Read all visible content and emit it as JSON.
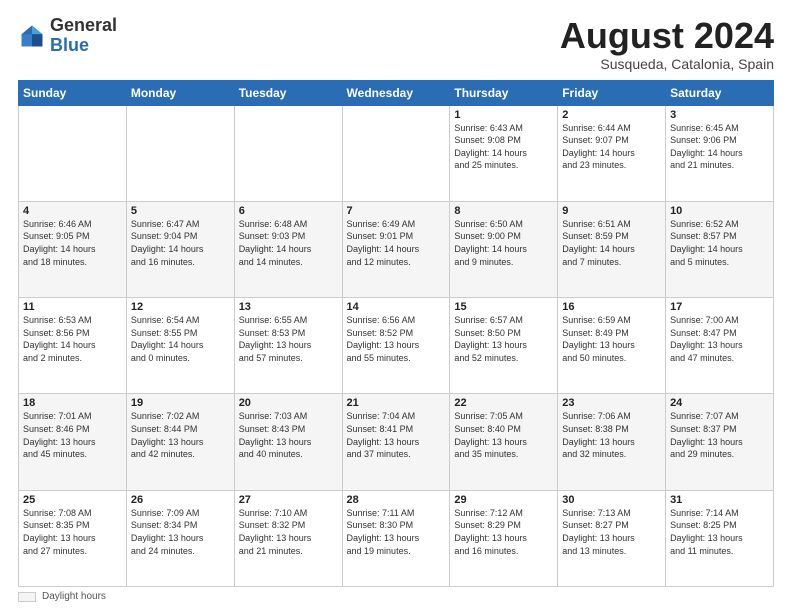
{
  "header": {
    "logo_general": "General",
    "logo_blue": "Blue",
    "month_year": "August 2024",
    "location": "Susqueda, Catalonia, Spain"
  },
  "weekdays": [
    "Sunday",
    "Monday",
    "Tuesday",
    "Wednesday",
    "Thursday",
    "Friday",
    "Saturday"
  ],
  "footer": {
    "label": "Daylight hours"
  },
  "weeks": [
    [
      {
        "day": "",
        "info": ""
      },
      {
        "day": "",
        "info": ""
      },
      {
        "day": "",
        "info": ""
      },
      {
        "day": "",
        "info": ""
      },
      {
        "day": "1",
        "info": "Sunrise: 6:43 AM\nSunset: 9:08 PM\nDaylight: 14 hours\nand 25 minutes."
      },
      {
        "day": "2",
        "info": "Sunrise: 6:44 AM\nSunset: 9:07 PM\nDaylight: 14 hours\nand 23 minutes."
      },
      {
        "day": "3",
        "info": "Sunrise: 6:45 AM\nSunset: 9:06 PM\nDaylight: 14 hours\nand 21 minutes."
      }
    ],
    [
      {
        "day": "4",
        "info": "Sunrise: 6:46 AM\nSunset: 9:05 PM\nDaylight: 14 hours\nand 18 minutes."
      },
      {
        "day": "5",
        "info": "Sunrise: 6:47 AM\nSunset: 9:04 PM\nDaylight: 14 hours\nand 16 minutes."
      },
      {
        "day": "6",
        "info": "Sunrise: 6:48 AM\nSunset: 9:03 PM\nDaylight: 14 hours\nand 14 minutes."
      },
      {
        "day": "7",
        "info": "Sunrise: 6:49 AM\nSunset: 9:01 PM\nDaylight: 14 hours\nand 12 minutes."
      },
      {
        "day": "8",
        "info": "Sunrise: 6:50 AM\nSunset: 9:00 PM\nDaylight: 14 hours\nand 9 minutes."
      },
      {
        "day": "9",
        "info": "Sunrise: 6:51 AM\nSunset: 8:59 PM\nDaylight: 14 hours\nand 7 minutes."
      },
      {
        "day": "10",
        "info": "Sunrise: 6:52 AM\nSunset: 8:57 PM\nDaylight: 14 hours\nand 5 minutes."
      }
    ],
    [
      {
        "day": "11",
        "info": "Sunrise: 6:53 AM\nSunset: 8:56 PM\nDaylight: 14 hours\nand 2 minutes."
      },
      {
        "day": "12",
        "info": "Sunrise: 6:54 AM\nSunset: 8:55 PM\nDaylight: 14 hours\nand 0 minutes."
      },
      {
        "day": "13",
        "info": "Sunrise: 6:55 AM\nSunset: 8:53 PM\nDaylight: 13 hours\nand 57 minutes."
      },
      {
        "day": "14",
        "info": "Sunrise: 6:56 AM\nSunset: 8:52 PM\nDaylight: 13 hours\nand 55 minutes."
      },
      {
        "day": "15",
        "info": "Sunrise: 6:57 AM\nSunset: 8:50 PM\nDaylight: 13 hours\nand 52 minutes."
      },
      {
        "day": "16",
        "info": "Sunrise: 6:59 AM\nSunset: 8:49 PM\nDaylight: 13 hours\nand 50 minutes."
      },
      {
        "day": "17",
        "info": "Sunrise: 7:00 AM\nSunset: 8:47 PM\nDaylight: 13 hours\nand 47 minutes."
      }
    ],
    [
      {
        "day": "18",
        "info": "Sunrise: 7:01 AM\nSunset: 8:46 PM\nDaylight: 13 hours\nand 45 minutes."
      },
      {
        "day": "19",
        "info": "Sunrise: 7:02 AM\nSunset: 8:44 PM\nDaylight: 13 hours\nand 42 minutes."
      },
      {
        "day": "20",
        "info": "Sunrise: 7:03 AM\nSunset: 8:43 PM\nDaylight: 13 hours\nand 40 minutes."
      },
      {
        "day": "21",
        "info": "Sunrise: 7:04 AM\nSunset: 8:41 PM\nDaylight: 13 hours\nand 37 minutes."
      },
      {
        "day": "22",
        "info": "Sunrise: 7:05 AM\nSunset: 8:40 PM\nDaylight: 13 hours\nand 35 minutes."
      },
      {
        "day": "23",
        "info": "Sunrise: 7:06 AM\nSunset: 8:38 PM\nDaylight: 13 hours\nand 32 minutes."
      },
      {
        "day": "24",
        "info": "Sunrise: 7:07 AM\nSunset: 8:37 PM\nDaylight: 13 hours\nand 29 minutes."
      }
    ],
    [
      {
        "day": "25",
        "info": "Sunrise: 7:08 AM\nSunset: 8:35 PM\nDaylight: 13 hours\nand 27 minutes."
      },
      {
        "day": "26",
        "info": "Sunrise: 7:09 AM\nSunset: 8:34 PM\nDaylight: 13 hours\nand 24 minutes."
      },
      {
        "day": "27",
        "info": "Sunrise: 7:10 AM\nSunset: 8:32 PM\nDaylight: 13 hours\nand 21 minutes."
      },
      {
        "day": "28",
        "info": "Sunrise: 7:11 AM\nSunset: 8:30 PM\nDaylight: 13 hours\nand 19 minutes."
      },
      {
        "day": "29",
        "info": "Sunrise: 7:12 AM\nSunset: 8:29 PM\nDaylight: 13 hours\nand 16 minutes."
      },
      {
        "day": "30",
        "info": "Sunrise: 7:13 AM\nSunset: 8:27 PM\nDaylight: 13 hours\nand 13 minutes."
      },
      {
        "day": "31",
        "info": "Sunrise: 7:14 AM\nSunset: 8:25 PM\nDaylight: 13 hours\nand 11 minutes."
      }
    ]
  ]
}
